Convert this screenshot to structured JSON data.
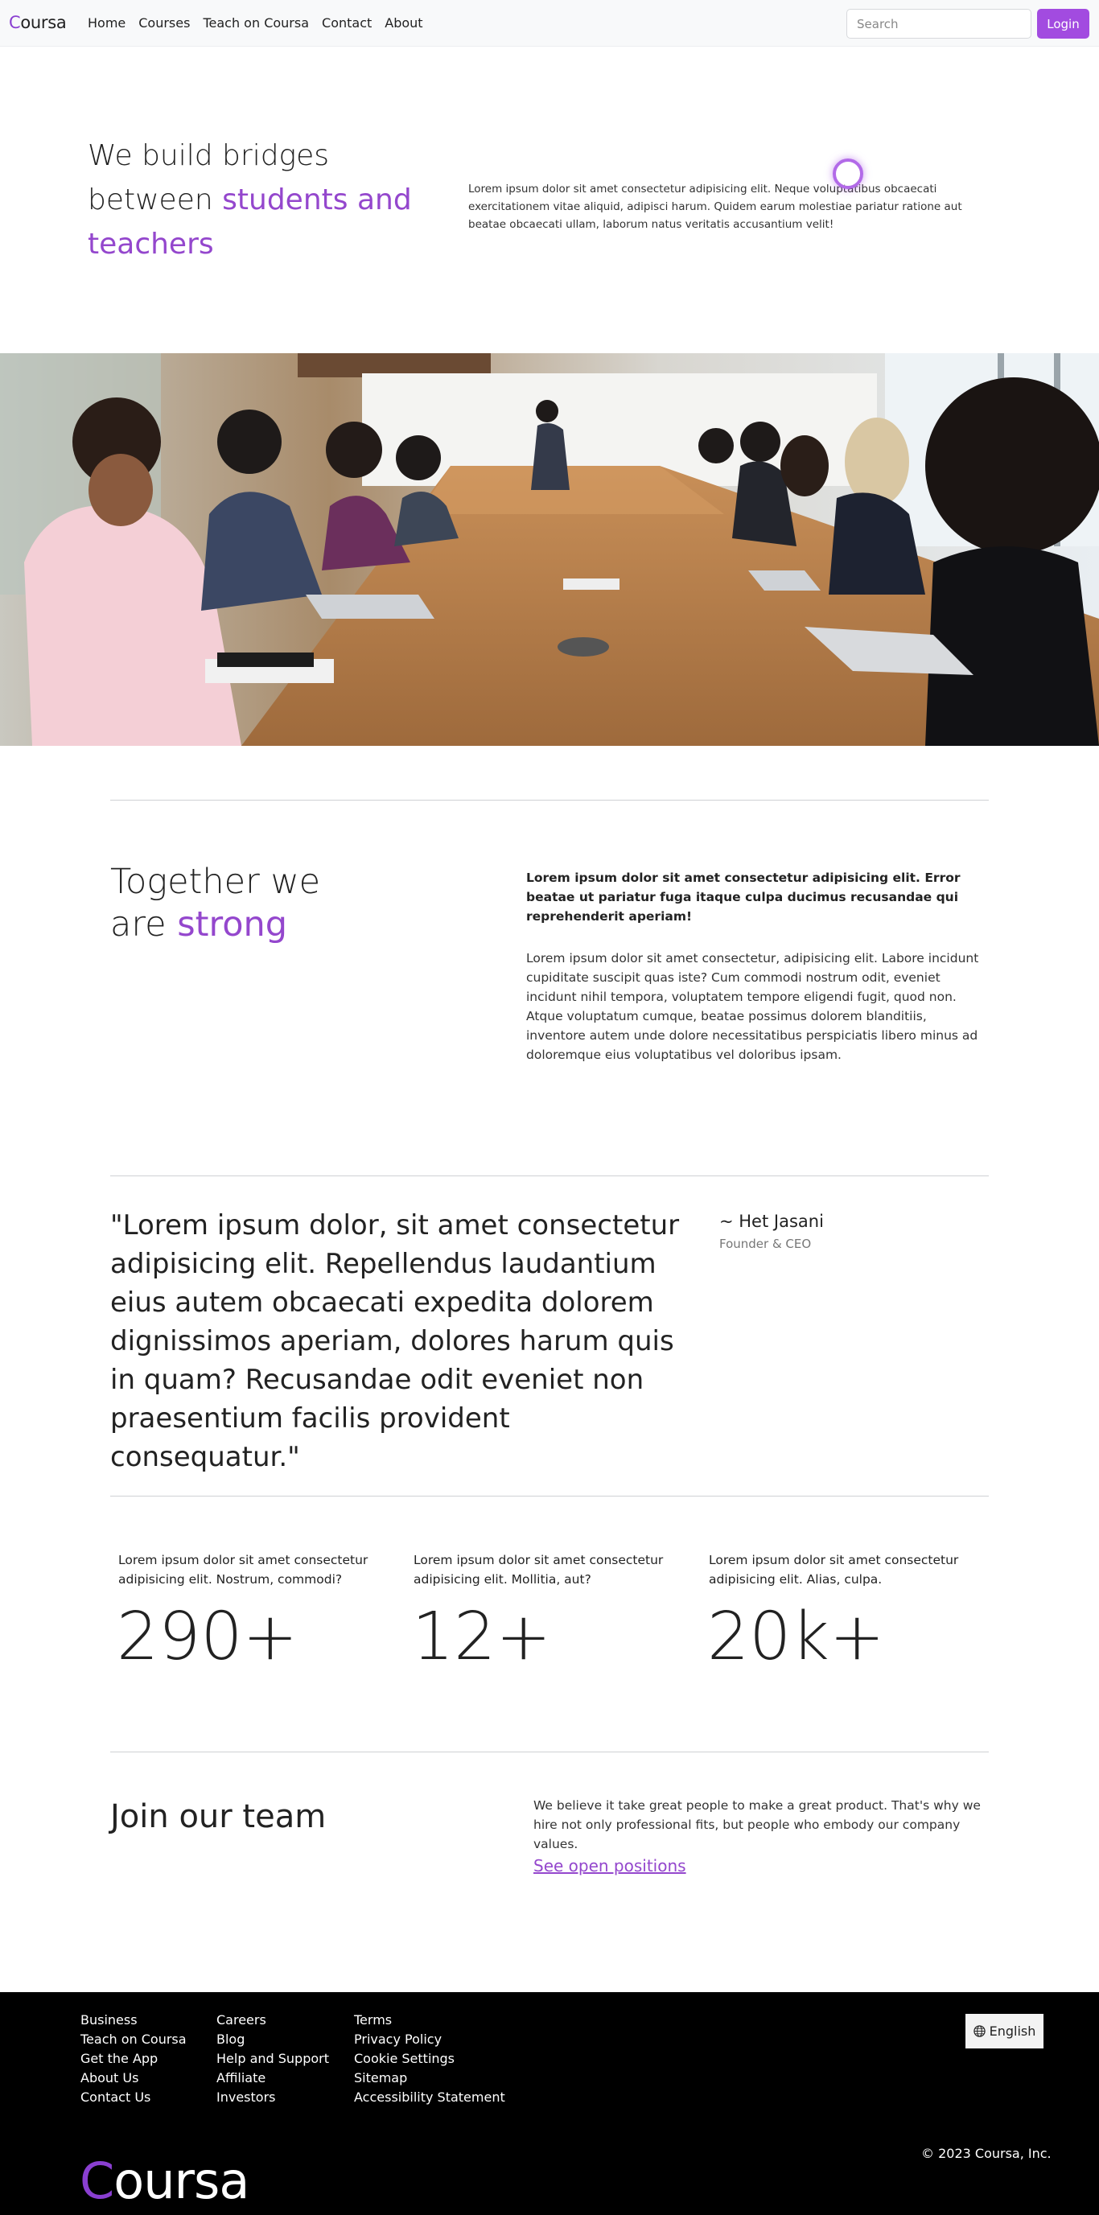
{
  "navbar": {
    "brand_first": "C",
    "brand_rest": "oursa",
    "links": [
      "Home",
      "Courses",
      "Teach on Coursa",
      "Contact",
      "About"
    ],
    "search_placeholder": "Search",
    "login_label": "Login"
  },
  "hero": {
    "title_plain_1": "We build bridges",
    "title_plain_2": "between ",
    "title_accent": "students and teachers",
    "text": "Lorem ipsum dolor sit amet consectetur adipisicing elit. Neque voluptatibus obcaecati exercitationem vitae aliquid, adipisci harum. Quidem earum molestiae pariatur ratione aut beatae obcaecati ullam, laborum natus veritatis accusantium velit!"
  },
  "together": {
    "title_plain_1": "Together we",
    "title_plain_2": "are ",
    "title_accent": "strong",
    "bold_text": "Lorem ipsum dolor sit amet consectetur adipisicing elit. Error beatae ut pariatur fuga itaque culpa ducimus recusandae qui reprehenderit aperiam!",
    "text": "Lorem ipsum dolor sit amet consectetur, adipisicing elit. Labore incidunt cupiditate suscipit quas iste? Cum commodi nostrum odit, eveniet incidunt nihil tempora, voluptatem tempore eligendi fugit, quod non. Atque voluptatum cumque, beatae possimus dolorem blanditiis, inventore autem unde dolore necessitatibus perspiciatis libero minus ad doloremque eius voluptatibus vel doloribus ipsam."
  },
  "quote": {
    "text": "\"Lorem ipsum dolor, sit amet consectetur adipisicing elit. Repellendus laudantium eius autem obcaecati expedita dolorem dignissimos aperiam, dolores harum quis in quam? Recusandae odit eveniet non praesentium facilis provident consequatur.\"",
    "author": "~ Het Jasani",
    "role": "Founder & CEO"
  },
  "stats": [
    {
      "label": "Lorem ipsum dolor sit amet consectetur adipisicing elit. Nostrum, commodi?",
      "value": "290+"
    },
    {
      "label": "Lorem ipsum dolor sit amet consectetur adipisicing elit. Mollitia, aut?",
      "value": "12+"
    },
    {
      "label": "Lorem ipsum dolor sit amet consectetur adipisicing elit. Alias, culpa.",
      "value": "20k+"
    }
  ],
  "join": {
    "title": "Join our team",
    "text": "We believe it take great people to make a great product. That's why we hire not only professional fits, but people who embody our company values.",
    "link": "See open positions"
  },
  "footer": {
    "col1": [
      "Business",
      "Teach on Coursa",
      "Get the App",
      "About Us",
      "Contact Us"
    ],
    "col2": [
      "Careers",
      "Blog",
      "Help and Support",
      "Affiliate",
      "Investors"
    ],
    "col3": [
      "Terms",
      "Privacy Policy",
      "Cookie Settings",
      "Sitemap",
      "Accessibility Statement"
    ],
    "language": "English",
    "copyright": "© 2023 Coursa, Inc.",
    "brand_first": "C",
    "brand_rest": "oursa"
  },
  "colors": {
    "accent": "#9447cd",
    "login_button": "#a24be0",
    "footer_bg": "#000000"
  }
}
